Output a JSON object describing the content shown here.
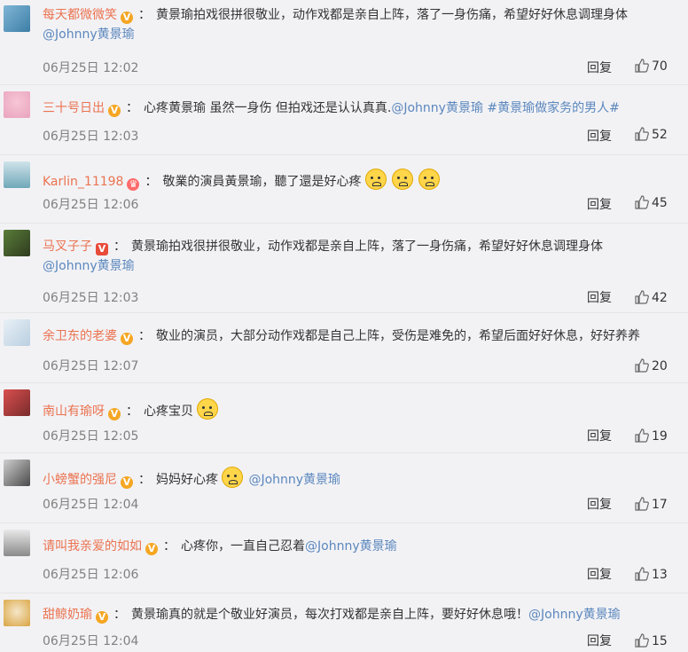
{
  "labels": {
    "reply": "回复",
    "sep": "："
  },
  "comments": [
    {
      "username": "每天都微微笑",
      "badge": "V",
      "text": "黄景瑜拍戏很拼很敬业，动作戏都是亲自上阵，落了一身伤痛，希望好好休息调理身体",
      "mention": "@Johnny黄景瑜",
      "time": "06月25日 12:02",
      "likes": "70"
    },
    {
      "username": "三十号日出",
      "badge": "V",
      "text": "心疼黄景瑜 虽然一身伤 但拍戏还是认认真真.",
      "mention": "@Johnny黄景瑜",
      "tag": "#黄景瑜做家务的男人#",
      "time": "06月25日 12:03",
      "likes": "52"
    },
    {
      "username": "Karlin_11198",
      "badge": "♛",
      "text": "敬業的演員黃景瑜，聽了還是好心疼",
      "emoji": "hug-emoji",
      "time": "06月25日 12:06",
      "likes": "45"
    },
    {
      "username": "马叉子子",
      "badge": "V",
      "text": "黄景瑜拍戏很拼很敬业，动作戏都是亲自上阵，落了一身伤痛，希望好好休息调理身体",
      "mention": "@Johnny黄景瑜",
      "time": "06月25日 12:03",
      "likes": "42"
    },
    {
      "username": "余卫东的老婆",
      "badge": "V",
      "text": "敬业的演员，大部分动作戏都是自己上阵，受伤是难免的，希望后面好好休息，好好养养",
      "time": "06月25日 12:07",
      "likes": "20"
    },
    {
      "username": "南山有瑜呀",
      "badge": "V",
      "text": "心疼宝贝",
      "emoji": "sad-emoji",
      "time": "06月25日 12:05",
      "likes": "19"
    },
    {
      "username": "小螃蟹的强尼",
      "badge": "V",
      "text": "妈妈好心疼",
      "emoji": "cry-emoji",
      "mention": "@Johnny黄景瑜",
      "time": "06月25日 12:04",
      "likes": "17"
    },
    {
      "username": "请叫我亲爱的如如",
      "badge": "V",
      "text": "心疼你，一直自己忍着",
      "mention": "@Johnny黄景瑜",
      "time": "06月25日 12:06",
      "likes": "13"
    },
    {
      "username": "甜鲸奶瑜",
      "badge": "V",
      "text": "黄景瑜真的就是个敬业好演员，每次打戏都是亲自上阵，要好好休息哦！",
      "mention": "@Johnny黄景瑜",
      "time": "06月25日 12:04",
      "likes": "15"
    }
  ],
  "colors": {
    "username": "#eb7350",
    "link": "#5b87bd",
    "time": "#808080",
    "badge": "#f5a623"
  }
}
